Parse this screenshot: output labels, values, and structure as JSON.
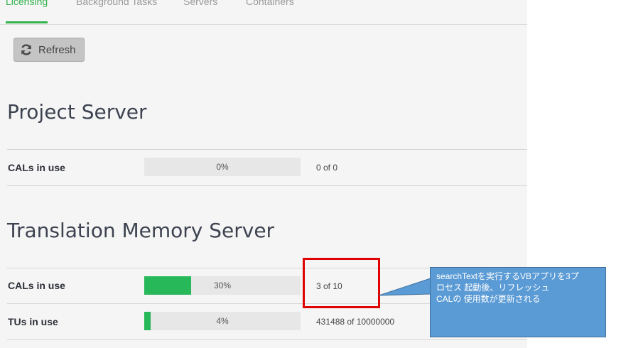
{
  "tabs": [
    {
      "label": "Licensing",
      "active": true
    },
    {
      "label": "Background Tasks",
      "active": false
    },
    {
      "label": "Servers",
      "active": false
    },
    {
      "label": "Containers",
      "active": false
    }
  ],
  "refresh": {
    "label": "Refresh",
    "icon": "refresh-icon"
  },
  "sections": [
    {
      "title": "Project Server",
      "rows": [
        {
          "label": "CALs in use",
          "percent_text": "0%",
          "fill_fraction": 0.0,
          "count": "0 of 0"
        }
      ]
    },
    {
      "title": "Translation Memory Server",
      "rows": [
        {
          "label": "CALs in use",
          "percent_text": "30%",
          "fill_fraction": 0.3,
          "count": "3 of 10"
        },
        {
          "label": "TUs in use",
          "percent_text": "4%",
          "fill_fraction": 0.04,
          "count": "431488 of 10000000"
        }
      ]
    }
  ],
  "annotation": {
    "line1": "searchTextを実行するVBアプリを3プ",
    "line2": "ロセス 起動後、リフレッシュ",
    "line3": "CALの 使用数が更新される"
  },
  "colors": {
    "accent": "#33b24d",
    "bar_fill": "#27b85a",
    "highlight": "#e00000",
    "callout": "#5b9bd5"
  }
}
